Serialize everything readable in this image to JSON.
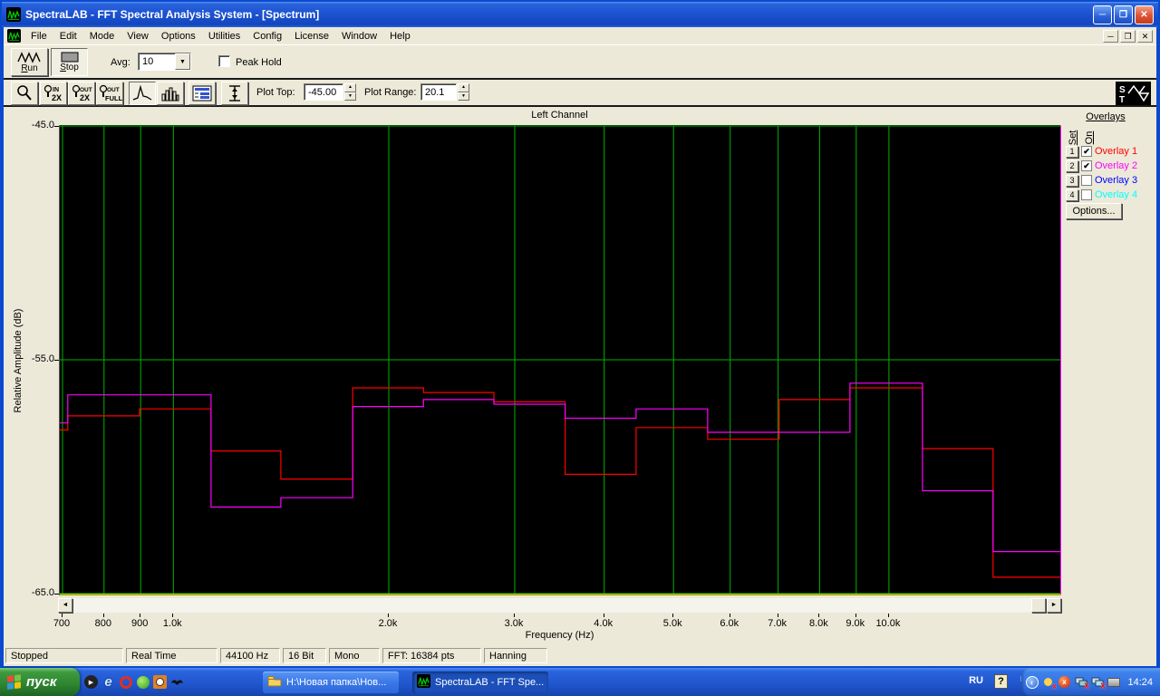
{
  "window": {
    "title": "SpectraLAB - FFT Spectral Analysis System - [Spectrum]",
    "menu_items": [
      "File",
      "Edit",
      "Mode",
      "View",
      "Options",
      "Utilities",
      "Config",
      "License",
      "Window",
      "Help"
    ],
    "titlebar_buttons": [
      "minimize",
      "maximize",
      "close"
    ],
    "mdi_buttons": [
      "minimize",
      "restore",
      "close"
    ]
  },
  "toolbar1": {
    "run_label": "Run",
    "stop_label": "Stop",
    "avg_label": "Avg:",
    "avg_value": "10",
    "peak_hold_label": "Peak Hold",
    "peak_hold_checked": false
  },
  "toolbar2": {
    "zoom_in_line1": "IN",
    "zoom_in_line2": "2X",
    "zoom_out_line1": "OUT",
    "zoom_out_line2": "2X",
    "zoom_full_line1": "OUT",
    "zoom_full_line2": "FULL",
    "plot_top_label": "Plot Top:",
    "plot_top_value": "-45.00",
    "plot_range_label": "Plot Range:",
    "plot_range_value": "20.1",
    "generator_letters": [
      "S",
      "T"
    ]
  },
  "chart": {
    "title": "Left Channel",
    "ylabel": "Relative Amplitude (dB)",
    "xlabel": "Frequency (Hz)",
    "overlays": {
      "title": "Overlays",
      "set_label": "Set",
      "on_label": "On",
      "items": [
        {
          "num": "1",
          "label": "Overlay 1",
          "color": "#ff0000",
          "checked": true
        },
        {
          "num": "2",
          "label": "Overlay 2",
          "color": "#ff00ff",
          "checked": true
        },
        {
          "num": "3",
          "label": "Overlay 3",
          "color": "#0000ff",
          "checked": false
        },
        {
          "num": "4",
          "label": "Overlay 4",
          "color": "#00ffff",
          "checked": false
        }
      ],
      "options_label": "Options..."
    }
  },
  "chart_data": {
    "type": "line",
    "subtype": "stepped-spectrum",
    "x_scale": "log",
    "title": "Left Channel",
    "xlabel": "Frequency (Hz)",
    "ylabel": "Relative Amplitude (dB)",
    "ylim": [
      -65,
      -45
    ],
    "xlim_hz": [
      694,
      17389
    ],
    "grid": true,
    "grid_color": "#00b400",
    "axis_bottom_color": "#d6d600",
    "background": "#000000",
    "yticks": [
      {
        "label": "-45.0",
        "db": -45
      },
      {
        "label": "-55.0",
        "db": -55
      },
      {
        "label": "-65.0",
        "db": -65
      }
    ],
    "xticks": [
      {
        "label": "700",
        "hz": 700
      },
      {
        "label": "800",
        "hz": 800
      },
      {
        "label": "900",
        "hz": 900
      },
      {
        "label": "1.0k",
        "hz": 1000
      },
      {
        "label": "2.0k",
        "hz": 2000
      },
      {
        "label": "3.0k",
        "hz": 3000
      },
      {
        "label": "4.0k",
        "hz": 4000
      },
      {
        "label": "5.0k",
        "hz": 5000
      },
      {
        "label": "6.0k",
        "hz": 6000
      },
      {
        "label": "7.0k",
        "hz": 7000
      },
      {
        "label": "8.0k",
        "hz": 8000
      },
      {
        "label": "9.0k",
        "hz": 9000
      },
      {
        "label": "10.0k",
        "hz": 10000
      }
    ],
    "band_edges_hz": [
      694,
      712,
      897,
      1129,
      1413,
      1781,
      2236,
      2805,
      3528,
      4432,
      5580,
      7024,
      8821,
      11139,
      13980,
      17389
    ],
    "series": [
      {
        "name": "Overlay 1",
        "color": "#ff0000",
        "values_db": [
          -58.0,
          -57.4,
          -57.1,
          -58.9,
          -60.1,
          -56.2,
          -56.4,
          -56.8,
          -59.9,
          -57.9,
          -58.4,
          -56.7,
          -56.2,
          -58.8,
          -64.3
        ]
      },
      {
        "name": "Overlay 2",
        "color": "#ff00ff",
        "values_db": [
          -57.7,
          -56.5,
          -56.5,
          -61.3,
          -60.9,
          -57.0,
          -56.7,
          -56.9,
          -57.5,
          -57.1,
          -58.1,
          -58.1,
          -56.0,
          -60.6,
          -63.2
        ]
      }
    ]
  },
  "status_bar": {
    "cells": [
      "Stopped",
      "Real Time",
      "44100 Hz",
      "16 Bit",
      "Mono",
      "FFT: 16384 pts",
      "Hanning"
    ]
  },
  "taskbar": {
    "start_label": "пуск",
    "quick_launch": [
      "media-player-icon",
      "ie-icon",
      "opera-icon",
      "messenger-icon",
      "clock-icon",
      "bat-icon"
    ],
    "buttons": [
      {
        "label": "H:\\Новая папка\\Нов...",
        "icon": "folder-icon",
        "active": false
      },
      {
        "label": "SpectraLAB - FFT Spe...",
        "icon": "spectralab-icon",
        "active": true
      }
    ],
    "tray": {
      "lang": "RU",
      "time": "14:24",
      "icons": [
        "chevron-left-icon",
        "volume-muted-icon",
        "opera-tray-icon",
        "network-offline-icon",
        "network-offline2-icon",
        "devices-icon"
      ]
    }
  }
}
